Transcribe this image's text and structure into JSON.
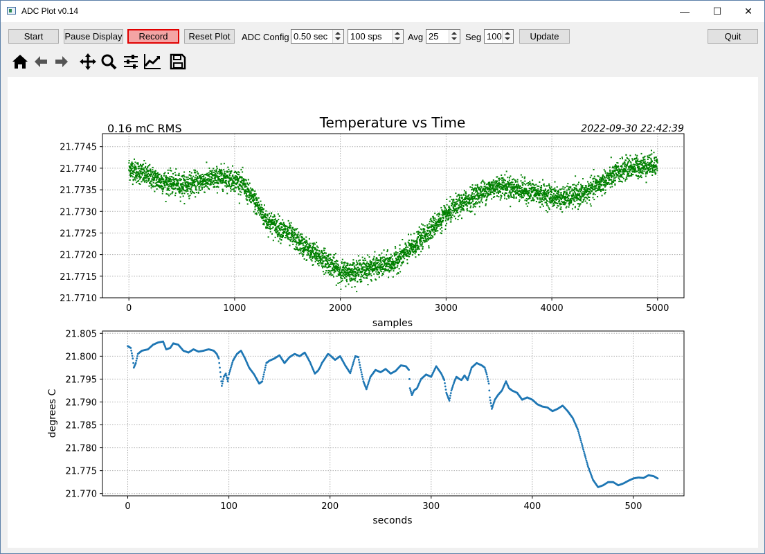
{
  "window": {
    "title": "ADC Plot v0.14",
    "minimize": "—",
    "maximize": "☐",
    "close": "✕"
  },
  "toolbar": {
    "start": "Start",
    "pause": "Pause Display",
    "record": "Record",
    "reset": "Reset Plot",
    "adc_config_label": "ADC Config",
    "duration": "0.50 sec",
    "rate": "100 sps",
    "avg_label": "Avg",
    "avg": "25",
    "seg_label": "Seg",
    "seg": "100",
    "update": "Update",
    "quit": "Quit",
    "record_color": "#e00000"
  },
  "nav_icons": [
    "home-icon",
    "back-icon",
    "forward-icon",
    "pan-icon",
    "zoom-icon",
    "configure-subplots-icon",
    "edit-axes-icon",
    "save-icon"
  ],
  "figure": {
    "rms_text": "0.16 mC RMS",
    "timestamp": "2022-09-30 22:42:39"
  },
  "chart_data": [
    {
      "type": "scatter",
      "title": "Temperature vs Time",
      "xlabel": "samples",
      "ylabel": "",
      "xlim": [
        -250,
        5250
      ],
      "ylim": [
        21.771,
        21.7748
      ],
      "xticks": [
        0,
        1000,
        2000,
        3000,
        4000,
        5000
      ],
      "yticks": [
        "21.7710",
        "21.7715",
        "21.7720",
        "21.7725",
        "21.7730",
        "21.7735",
        "21.7740",
        "21.7745"
      ],
      "grid": true,
      "color": "#008000",
      "n_points": 5000,
      "trend": {
        "x": [
          0,
          100,
          300,
          500,
          700,
          900,
          1050,
          1200,
          1300,
          1500,
          1700,
          1900,
          2000,
          2100,
          2300,
          2500,
          2700,
          2900,
          3100,
          3300,
          3500,
          3700,
          3900,
          4100,
          4300,
          4500,
          4700,
          5000
        ],
        "y": [
          21.774,
          21.7739,
          21.7737,
          21.7736,
          21.7737,
          21.7738,
          21.7737,
          21.7732,
          21.7728,
          21.7725,
          21.7721,
          21.7718,
          21.7716,
          21.7716,
          21.7717,
          21.7718,
          21.7722,
          21.7727,
          21.7731,
          21.7734,
          21.7736,
          21.7735,
          21.7734,
          21.7733,
          21.7734,
          21.7737,
          21.774,
          21.7741
        ]
      },
      "noise": 0.00016
    },
    {
      "type": "scatter",
      "title": "",
      "xlabel": "seconds",
      "ylabel": "degrees C",
      "xlim": [
        -25,
        550
      ],
      "ylim": [
        21.7695,
        21.8055
      ],
      "xticks": [
        0,
        100,
        200,
        300,
        400,
        500
      ],
      "yticks": [
        "21.770",
        "21.775",
        "21.780",
        "21.785",
        "21.790",
        "21.795",
        "21.800",
        "21.805"
      ],
      "grid": true,
      "color": "#1f77b4",
      "x": [
        0,
        3,
        5,
        6,
        8,
        10,
        14,
        20,
        25,
        30,
        35,
        38,
        42,
        45,
        50,
        55,
        60,
        65,
        70,
        75,
        80,
        85,
        88,
        90,
        91,
        93,
        95,
        97,
        99,
        100,
        104,
        108,
        112,
        116,
        120,
        125,
        130,
        133,
        135,
        137,
        140,
        145,
        150,
        155,
        160,
        165,
        170,
        175,
        180,
        185,
        188,
        190,
        192,
        195,
        198,
        200,
        205,
        210,
        215,
        220,
        225,
        228,
        230,
        233,
        236,
        240,
        245,
        250,
        255,
        260,
        265,
        270,
        275,
        278,
        279,
        281,
        283,
        286,
        290,
        295,
        300,
        305,
        310,
        313,
        315,
        318,
        320,
        323,
        325,
        328,
        330,
        333,
        336,
        340,
        345,
        350,
        353,
        355,
        357,
        358,
        360,
        363,
        366,
        370,
        374,
        377,
        380,
        385,
        390,
        395,
        400,
        405,
        410,
        415,
        420,
        425,
        430,
        435,
        440,
        445,
        450,
        455,
        460,
        465,
        470,
        475,
        480,
        485,
        490,
        495,
        500,
        505,
        510,
        515,
        520,
        524
      ],
      "y": [
        21.8022,
        21.8018,
        21.7995,
        21.7975,
        21.7985,
        21.8005,
        21.8012,
        21.8015,
        21.8025,
        21.803,
        21.8032,
        21.8015,
        21.8018,
        21.8028,
        21.8025,
        21.8012,
        21.8008,
        21.8015,
        21.801,
        21.8012,
        21.8015,
        21.8012,
        21.8005,
        21.7995,
        21.7975,
        21.7935,
        21.7955,
        21.7962,
        21.7945,
        21.796,
        21.799,
        21.8005,
        21.8012,
        21.7995,
        21.7975,
        21.796,
        21.794,
        21.7945,
        21.7965,
        21.7985,
        21.799,
        21.7995,
        21.8002,
        21.7985,
        21.7998,
        21.8005,
        21.8,
        21.8008,
        21.7988,
        21.7962,
        21.7968,
        21.7975,
        21.7985,
        21.7995,
        21.8005,
        21.8002,
        21.7992,
        21.8,
        21.798,
        21.7963,
        21.8,
        21.7998,
        21.7975,
        21.7945,
        21.7928,
        21.7955,
        21.797,
        21.7965,
        21.7972,
        21.7962,
        21.7968,
        21.798,
        21.7978,
        21.797,
        21.793,
        21.7915,
        21.7925,
        21.793,
        21.795,
        21.796,
        21.7955,
        21.7978,
        21.7962,
        21.7948,
        21.792,
        21.7903,
        21.7925,
        21.7945,
        21.7955,
        21.795,
        21.7948,
        21.7958,
        21.7948,
        21.7975,
        21.7985,
        21.798,
        21.7975,
        21.796,
        21.794,
        21.791,
        21.7885,
        21.7905,
        21.7915,
        21.7925,
        21.7945,
        21.793,
        21.7925,
        21.792,
        21.7905,
        21.791,
        21.7905,
        21.7895,
        21.789,
        21.7888,
        21.788,
        21.7885,
        21.7892,
        21.788,
        21.7865,
        21.784,
        21.78,
        21.776,
        21.773,
        21.7714,
        21.7718,
        21.7725,
        21.7725,
        21.7718,
        21.7722,
        21.7728,
        21.7733,
        21.7735,
        21.7734,
        21.774,
        21.7738,
        21.7733
      ]
    }
  ]
}
